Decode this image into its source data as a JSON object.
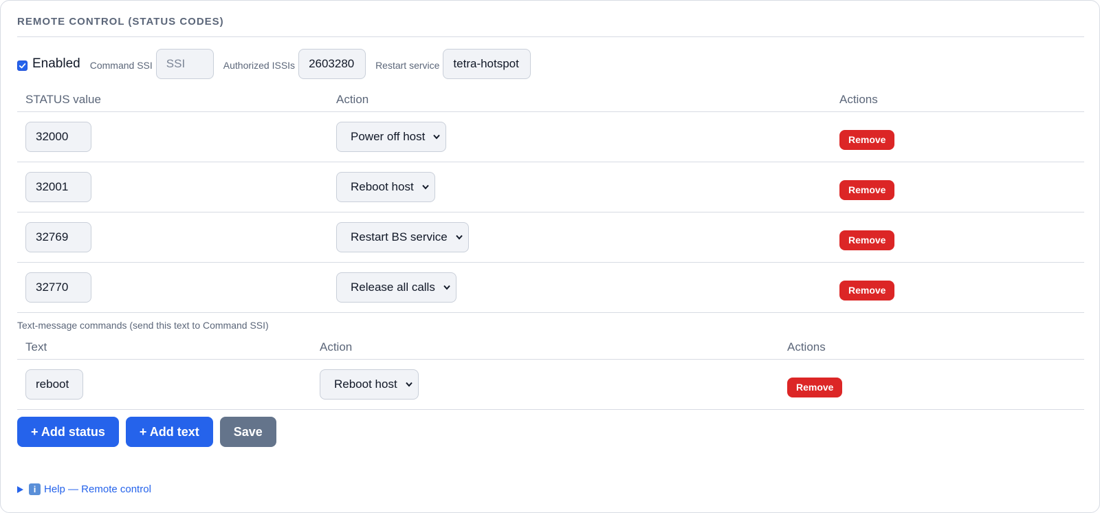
{
  "panel": {
    "title": "REMOTE CONTROL (STATUS CODES)",
    "enabled_label": "Enabled",
    "enabled_checked": true,
    "command_ssi_label": "Command SSI",
    "command_ssi_value": "",
    "command_ssi_placeholder": "SSI",
    "authorized_issis_label": "Authorized ISSIs",
    "authorized_issis_value": "2603280",
    "restart_service_label": "Restart service",
    "restart_service_value": "tetra-hotspot"
  },
  "status_table": {
    "headers": [
      "STATUS value",
      "Action",
      "Actions"
    ],
    "rows": [
      {
        "value": "32000",
        "action": "Power off host",
        "remove": "Remove"
      },
      {
        "value": "32001",
        "action": "Reboot host",
        "remove": "Remove"
      },
      {
        "value": "32769",
        "action": "Restart BS service",
        "remove": "Remove"
      },
      {
        "value": "32770",
        "action": "Release all calls",
        "remove": "Remove"
      }
    ]
  },
  "text_commands": {
    "subtitle": "Text-message commands (send this text to Command SSI)",
    "headers": [
      "Text",
      "Action",
      "Actions"
    ],
    "rows": [
      {
        "text": "reboot",
        "action": "Reboot host",
        "remove": "Remove"
      }
    ]
  },
  "buttons": {
    "add_status": "+ Add status",
    "add_text": "+ Add text",
    "save": "Save"
  },
  "help": {
    "icon": "info-icon",
    "icon_glyph": "i",
    "label": "Help — Remote control"
  },
  "colors": {
    "accent": "#2563eb",
    "danger": "#dc2626",
    "secondary": "#64748b",
    "muted_text": "#5b6679"
  }
}
